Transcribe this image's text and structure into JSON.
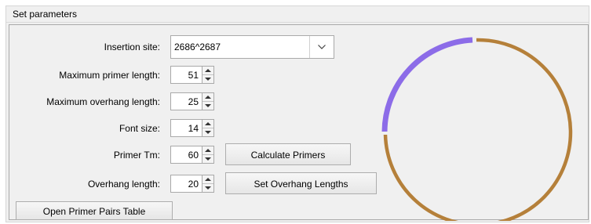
{
  "panel": {
    "title": "Set parameters"
  },
  "form": {
    "insertion_site": {
      "label": "Insertion site:",
      "value": "2686^2687"
    },
    "max_primer_length": {
      "label": "Maximum primer length:",
      "value": "51"
    },
    "max_overhang_length": {
      "label": "Maximum overhang length:",
      "value": "25"
    },
    "font_size": {
      "label": "Font size:",
      "value": "14"
    },
    "primer_tm": {
      "label": "Primer Tm:",
      "value": "60"
    },
    "overhang_length": {
      "label": "Overhang length:",
      "value": "20"
    }
  },
  "buttons": {
    "calculate_primers": "Calculate Primers",
    "set_overhang_lengths": "Set Overhang Lengths",
    "open_primer_pairs_table": "Open Primer Pairs Table"
  },
  "icons": {
    "combo_dropdown": "chevron-down-icon",
    "spinner_up": "arrow-up-icon",
    "spinner_down": "arrow-down-icon"
  },
  "colors": {
    "selected_arc": "#8c6ce8",
    "plasmid_arc": "#b5803a"
  }
}
